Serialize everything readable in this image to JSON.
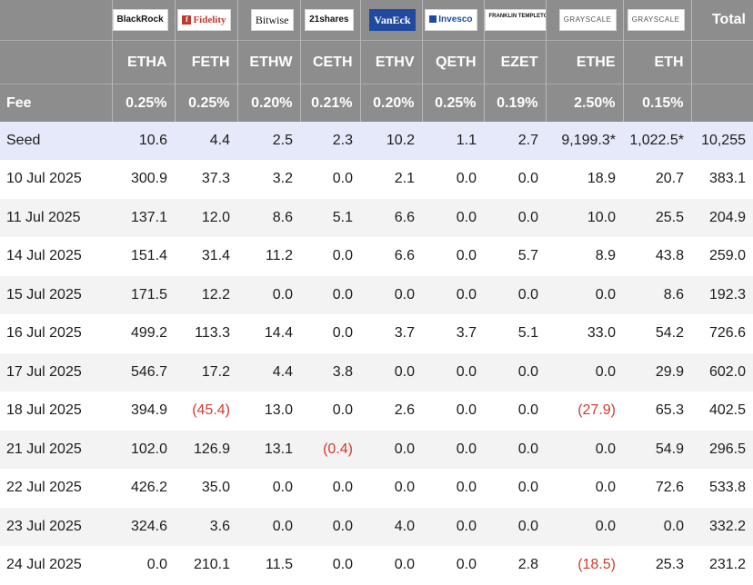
{
  "issuers": [
    {
      "name": "BlackRock",
      "icon": "blackrock-logo",
      "ticker": "ETHA",
      "fee": "0.25%"
    },
    {
      "name": "Fidelity",
      "icon": "fidelity-logo",
      "ticker": "FETH",
      "fee": "0.25%"
    },
    {
      "name": "Bitwise",
      "icon": "bitwise-logo",
      "ticker": "ETHW",
      "fee": "0.20%"
    },
    {
      "name": "21shares",
      "icon": "21shares-logo",
      "ticker": "CETH",
      "fee": "0.21%"
    },
    {
      "name": "VanEck",
      "icon": "vaneck-logo",
      "ticker": "ETHV",
      "fee": "0.20%"
    },
    {
      "name": "Invesco",
      "icon": "invesco-logo",
      "ticker": "QETH",
      "fee": "0.25%"
    },
    {
      "name": "FRANKLIN TEMPLETON",
      "icon": "franklin-templeton-logo",
      "ticker": "EZET",
      "fee": "0.19%"
    },
    {
      "name": "GRAYSCALE",
      "icon": "grayscale-logo",
      "ticker": "ETHE",
      "fee": "2.50%"
    },
    {
      "name": "GRAYSCALE",
      "icon": "grayscale-logo",
      "ticker": "ETH",
      "fee": "0.15%"
    }
  ],
  "header": {
    "total_label": "Total",
    "fee_label": "Fee"
  },
  "rows": [
    {
      "label": "Seed",
      "cells": [
        "10.6",
        "4.4",
        "2.5",
        "2.3",
        "10.2",
        "1.1",
        "2.7",
        "9,199.3*",
        "1,022.5*",
        "10,255"
      ]
    },
    {
      "label": "10 Jul 2025",
      "cells": [
        "300.9",
        "37.3",
        "3.2",
        "0.0",
        "2.1",
        "0.0",
        "0.0",
        "18.9",
        "20.7",
        "383.1"
      ]
    },
    {
      "label": "11 Jul 2025",
      "cells": [
        "137.1",
        "12.0",
        "8.6",
        "5.1",
        "6.6",
        "0.0",
        "0.0",
        "10.0",
        "25.5",
        "204.9"
      ]
    },
    {
      "label": "14 Jul 2025",
      "cells": [
        "151.4",
        "31.4",
        "11.2",
        "0.0",
        "6.6",
        "0.0",
        "5.7",
        "8.9",
        "43.8",
        "259.0"
      ]
    },
    {
      "label": "15 Jul 2025",
      "cells": [
        "171.5",
        "12.2",
        "0.0",
        "0.0",
        "0.0",
        "0.0",
        "0.0",
        "0.0",
        "8.6",
        "192.3"
      ]
    },
    {
      "label": "16 Jul 2025",
      "cells": [
        "499.2",
        "113.3",
        "14.4",
        "0.0",
        "3.7",
        "3.7",
        "5.1",
        "33.0",
        "54.2",
        "726.6"
      ]
    },
    {
      "label": "17 Jul 2025",
      "cells": [
        "546.7",
        "17.2",
        "4.4",
        "3.8",
        "0.0",
        "0.0",
        "0.0",
        "0.0",
        "29.9",
        "602.0"
      ]
    },
    {
      "label": "18 Jul 2025",
      "cells": [
        "394.9",
        "(45.4)",
        "13.0",
        "0.0",
        "2.6",
        "0.0",
        "0.0",
        "(27.9)",
        "65.3",
        "402.5"
      ]
    },
    {
      "label": "21 Jul 2025",
      "cells": [
        "102.0",
        "126.9",
        "13.1",
        "(0.4)",
        "0.0",
        "0.0",
        "0.0",
        "0.0",
        "54.9",
        "296.5"
      ]
    },
    {
      "label": "22 Jul 2025",
      "cells": [
        "426.2",
        "35.0",
        "0.0",
        "0.0",
        "0.0",
        "0.0",
        "0.0",
        "0.0",
        "72.6",
        "533.8"
      ]
    },
    {
      "label": "23 Jul 2025",
      "cells": [
        "324.6",
        "3.6",
        "0.0",
        "0.0",
        "4.0",
        "0.0",
        "0.0",
        "0.0",
        "0.0",
        "332.2"
      ]
    },
    {
      "label": "24 Jul 2025",
      "cells": [
        "0.0",
        "210.1",
        "11.5",
        "0.0",
        "0.0",
        "0.0",
        "2.8",
        "(18.5)",
        "25.3",
        "231.2"
      ]
    }
  ],
  "colors": {
    "header_bg": "#8d8d8d",
    "seed_bg": "#e5e9f9",
    "stripe_bg": "#f3f3f3",
    "negative": "#d33a2c"
  }
}
